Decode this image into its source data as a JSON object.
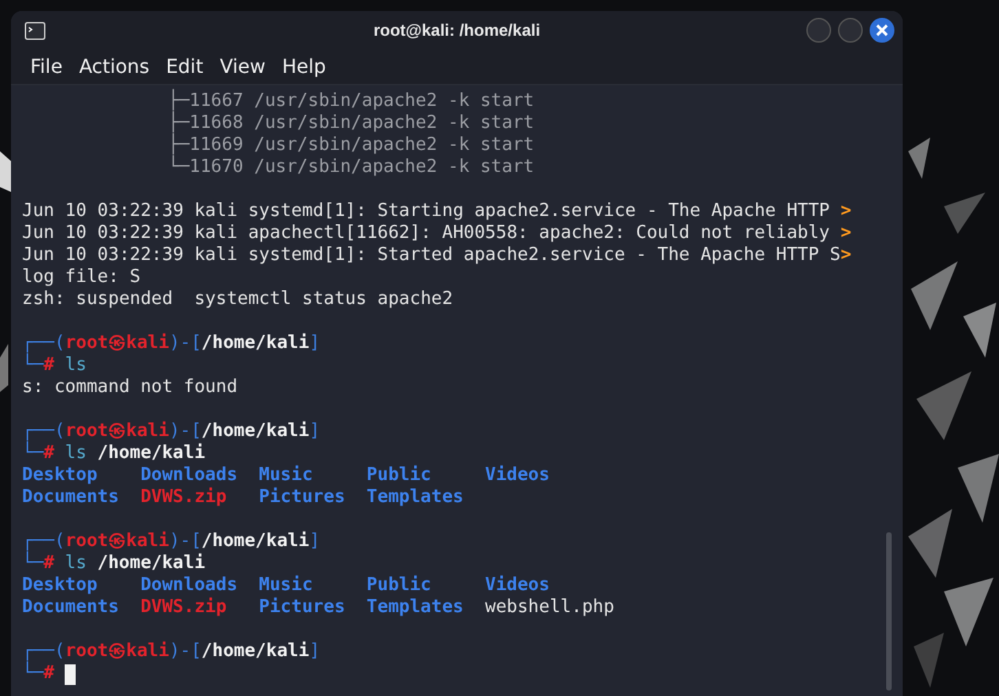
{
  "window": {
    "title": "root@kali: /home/kali"
  },
  "menu": [
    "File",
    "Actions",
    "Edit",
    "View",
    "Help"
  ],
  "terminal": {
    "lines": [
      {
        "kind": "tree",
        "text": "├─11667 /usr/sbin/apache2 -k start"
      },
      {
        "kind": "tree",
        "text": "├─11668 /usr/sbin/apache2 -k start"
      },
      {
        "kind": "tree",
        "text": "├─11669 /usr/sbin/apache2 -k start"
      },
      {
        "kind": "tree",
        "text": "└─11670 /usr/sbin/apache2 -k start"
      },
      {
        "kind": "blank"
      },
      {
        "kind": "log",
        "text": "Jun 10 03:22:39 kali systemd[1]: Starting apache2.service - The Apache HTTP ",
        "marker": ">"
      },
      {
        "kind": "log",
        "text": "Jun 10 03:22:39 kali apachectl[11662]: AH00558: apache2: Could not reliably ",
        "marker": ">"
      },
      {
        "kind": "log",
        "text": "Jun 10 03:22:39 kali systemd[1]: Started apache2.service - The Apache HTTP S",
        "marker": ">"
      },
      {
        "kind": "plain",
        "text": "log file: S"
      },
      {
        "kind": "plain",
        "text": "zsh: suspended  systemctl status apache2"
      },
      {
        "kind": "blank"
      },
      {
        "kind": "prompt",
        "top": "┌──(",
        "user": "root",
        "symbol": "㉿",
        "host": "kali",
        "sep": ")-[",
        "path": "/home/kali",
        "close": "]",
        "bottom": "└─",
        "sign": "#",
        "command": "ls",
        "cursor": false
      },
      {
        "kind": "plain",
        "text": "s: command not found"
      },
      {
        "kind": "blank"
      },
      {
        "kind": "prompt",
        "top": "┌──(",
        "user": "root",
        "symbol": "㉿",
        "host": "kali",
        "sep": ")-[",
        "path": "/home/kali",
        "close": "]",
        "bottom": "└─",
        "sign": "#",
        "command": "ls",
        "args": "/home/kali",
        "cursor": false
      },
      {
        "kind": "listing",
        "entries": [
          {
            "kind": "dir",
            "name": "Desktop"
          },
          {
            "kind": "dir",
            "name": "Downloads"
          },
          {
            "kind": "dir",
            "name": "Music"
          },
          {
            "kind": "dir",
            "name": "Public"
          },
          {
            "kind": "dir",
            "name": "Videos"
          }
        ]
      },
      {
        "kind": "listing",
        "entries": [
          {
            "kind": "dir",
            "name": "Documents"
          },
          {
            "kind": "archive",
            "name": "DVWS.zip"
          },
          {
            "kind": "dir",
            "name": "Pictures"
          },
          {
            "kind": "dir",
            "name": "Templates"
          }
        ]
      },
      {
        "kind": "blank"
      },
      {
        "kind": "prompt",
        "top": "┌──(",
        "user": "root",
        "symbol": "㉿",
        "host": "kali",
        "sep": ")-[",
        "path": "/home/kali",
        "close": "]",
        "bottom": "└─",
        "sign": "#",
        "command": "ls",
        "args": "/home/kali",
        "cursor": false
      },
      {
        "kind": "listing",
        "entries": [
          {
            "kind": "dir",
            "name": "Desktop"
          },
          {
            "kind": "dir",
            "name": "Downloads"
          },
          {
            "kind": "dir",
            "name": "Music"
          },
          {
            "kind": "dir",
            "name": "Public"
          },
          {
            "kind": "dir",
            "name": "Videos"
          }
        ]
      },
      {
        "kind": "listing",
        "entries": [
          {
            "kind": "dir",
            "name": "Documents"
          },
          {
            "kind": "archive",
            "name": "DVWS.zip"
          },
          {
            "kind": "dir",
            "name": "Pictures"
          },
          {
            "kind": "dir",
            "name": "Templates"
          },
          {
            "kind": "file",
            "name": "webshell.php"
          }
        ]
      },
      {
        "kind": "blank"
      },
      {
        "kind": "prompt",
        "top": "┌──(",
        "user": "root",
        "symbol": "㉿",
        "host": "kali",
        "sep": ")-[",
        "path": "/home/kali",
        "close": "]",
        "bottom": "└─",
        "sign": "#",
        "cursor": true
      }
    ]
  }
}
